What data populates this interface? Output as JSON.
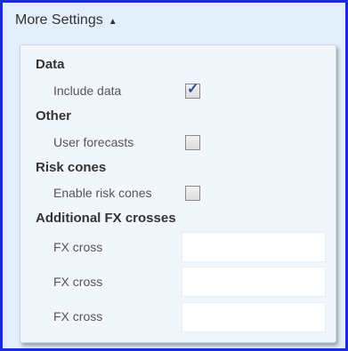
{
  "header": {
    "title": "More Settings",
    "toggle_icon": "triangle-up-icon"
  },
  "sections": {
    "data": {
      "title": "Data",
      "include_data_label": "Include data",
      "include_data_checked": true
    },
    "other": {
      "title": "Other",
      "user_forecasts_label": "User forecasts",
      "user_forecasts_checked": false
    },
    "risk_cones": {
      "title": "Risk cones",
      "enable_risk_cones_label": "Enable risk cones",
      "enable_risk_cones_checked": false
    },
    "fx": {
      "title": "Additional FX crosses",
      "rows": [
        {
          "label": "FX cross",
          "value": ""
        },
        {
          "label": "FX cross",
          "value": ""
        },
        {
          "label": "FX cross",
          "value": ""
        }
      ]
    }
  },
  "colors": {
    "border": "#1b2bd6",
    "background": "#e3effa",
    "panel": "#f0f6fc",
    "check": "#2a4e9a"
  }
}
